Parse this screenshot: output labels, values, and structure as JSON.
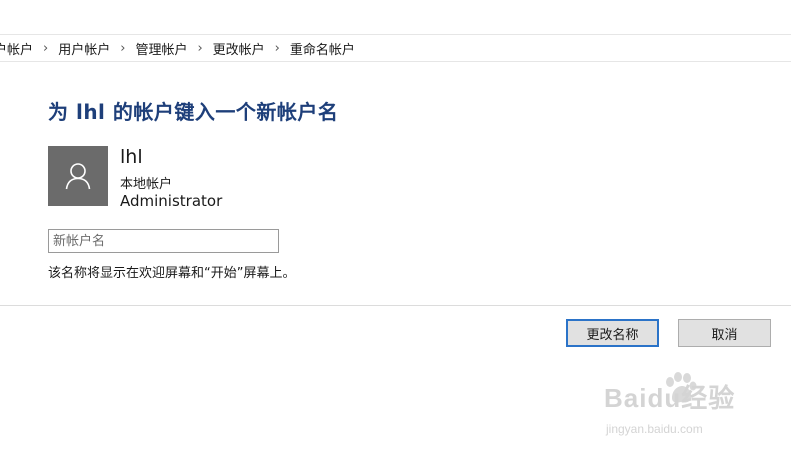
{
  "breadcrumb": {
    "items": [
      "户帐户",
      "用户帐户",
      "管理帐户",
      "更改帐户",
      "重命名帐户"
    ],
    "separator": "›"
  },
  "page": {
    "title": "为 lhl 的帐户键入一个新帐户名"
  },
  "account": {
    "avatar_icon": "user-silhouette-icon",
    "name": "lhl",
    "type": "本地帐户",
    "role": "Administrator"
  },
  "rename": {
    "input_value": "",
    "placeholder": "新帐户名",
    "hint": "该名称将显示在欢迎屏幕和“开始”屏幕上。"
  },
  "buttons": {
    "change_name": "更改名称",
    "cancel": "取消"
  },
  "colors": {
    "title": "#1e3f7a",
    "avatar_bg": "#6b6b6b",
    "primary_border": "#2b73c8",
    "button_bg": "#e1e1e1"
  },
  "watermark": {
    "logo_text": "Baidu经验",
    "url": "jingyan.baidu.com"
  }
}
